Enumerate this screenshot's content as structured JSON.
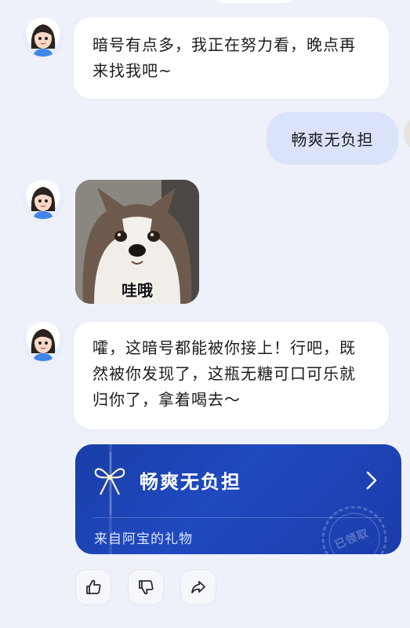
{
  "messages": {
    "m1": {
      "text": "暗号有点多，我正在努力看，晚点再来找我吧~"
    },
    "m2": {
      "text": "畅爽无负担"
    },
    "m3": {
      "sticker_caption": "哇哦"
    },
    "m4": {
      "text": "嚯，这暗号都能被你接上！行吧，既然被你发现了，这瓶无糖可口可乐就归你了，拿着喝去～"
    }
  },
  "gift_card": {
    "title": "畅爽无负担",
    "from": "来自阿宝的礼物",
    "stamp": "已领取",
    "icons": {
      "bow": "gift-bow-icon",
      "arrow": "chevron-right-icon"
    },
    "colors": {
      "background": "#1f49bf",
      "text": "#ffffff"
    }
  },
  "actions": {
    "icons": [
      "thumbs-up-icon",
      "thumbs-down-icon",
      "share-icon"
    ]
  },
  "colors": {
    "page_background": "#eef1f9",
    "assistant_bubble": "#ffffff",
    "user_bubble": "#dbe3fb"
  }
}
